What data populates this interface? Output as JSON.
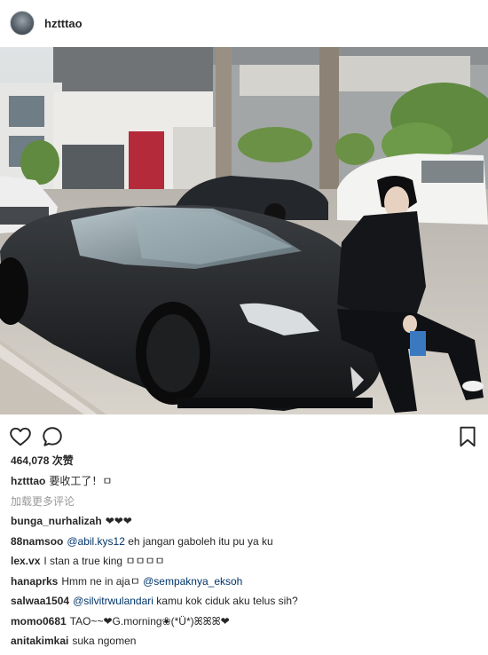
{
  "post": {
    "username": "hztttao",
    "likes_text": "464,078 次赞",
    "caption_text": "要收工了！ㅁ",
    "load_more_label": "加载更多评论"
  },
  "comments": [
    {
      "user": "bunga_nurhalizah",
      "pre": "",
      "mention": "",
      "text": "❤❤❤"
    },
    {
      "user": "88namsoo",
      "pre": "",
      "mention": "@abil.kys12",
      "text": " eh jangan gaboleh itu pu ya ku"
    },
    {
      "user": "lex.vx",
      "pre": "I stan a true king ",
      "mention": "",
      "text": "ㅁㅁㅁㅁ"
    },
    {
      "user": "hanaprks",
      "pre": "Hmm ne in ajaㅁ ",
      "mention": "@sempaknya_eksoh",
      "text": ""
    },
    {
      "user": "salwaa1504",
      "pre": "",
      "mention": "@silvitrwulandari",
      "text": " kamu kok ciduk aku telus sih?"
    },
    {
      "user": "momo0681",
      "pre": "TAO~~❤G.morning❀(*Ü*)ꕤꕤꕤ❤",
      "mention": "",
      "text": ""
    },
    {
      "user": "anitakimkai",
      "pre": "suka ngomen",
      "mention": "",
      "text": ""
    }
  ],
  "icons": {
    "like": "heart-outline-icon",
    "comment": "speech-bubble-icon",
    "save": "bookmark-icon"
  }
}
